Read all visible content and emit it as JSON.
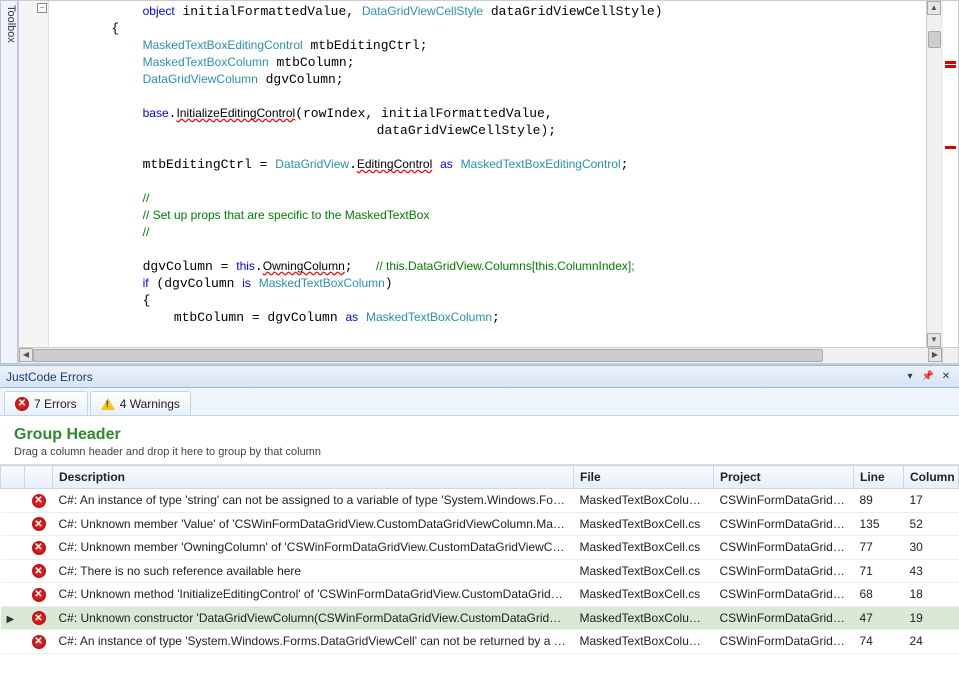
{
  "toolbox_label": "Toolbox",
  "code": {
    "lines": [
      {
        "indent": 12,
        "segs": [
          {
            "t": "object",
            "c": "kw"
          },
          {
            "t": " initialFormattedValue, "
          },
          {
            "t": "DataGridViewCellStyle",
            "c": "typ"
          },
          {
            "t": " dataGridViewCellStyle)"
          }
        ]
      },
      {
        "indent": 8,
        "segs": [
          {
            "t": "{"
          }
        ]
      },
      {
        "indent": 12,
        "segs": [
          {
            "t": "MaskedTextBoxEditingControl",
            "c": "typ"
          },
          {
            "t": " mtbEditingCtrl;"
          }
        ]
      },
      {
        "indent": 12,
        "segs": [
          {
            "t": "MaskedTextBoxColumn",
            "c": "typ"
          },
          {
            "t": " mtbColumn;"
          }
        ]
      },
      {
        "indent": 12,
        "segs": [
          {
            "t": "DataGridViewColumn",
            "c": "typ"
          },
          {
            "t": " dgvColumn;"
          }
        ]
      },
      {
        "indent": 0,
        "segs": [
          {
            "t": ""
          }
        ]
      },
      {
        "indent": 12,
        "segs": [
          {
            "t": "base",
            "c": "kw"
          },
          {
            "t": "."
          },
          {
            "t": "InitializeEditingControl",
            "c": "err"
          },
          {
            "t": "(rowIndex, initialFormattedValue,"
          }
        ]
      },
      {
        "indent": 42,
        "segs": [
          {
            "t": "dataGridViewCellStyle);"
          }
        ]
      },
      {
        "indent": 0,
        "segs": [
          {
            "t": ""
          }
        ]
      },
      {
        "indent": 12,
        "segs": [
          {
            "t": "mtbEditingCtrl = "
          },
          {
            "t": "DataGridView",
            "c": "typ"
          },
          {
            "t": "."
          },
          {
            "t": "EditingControl",
            "c": "err"
          },
          {
            "t": " "
          },
          {
            "t": "as",
            "c": "kw"
          },
          {
            "t": " "
          },
          {
            "t": "MaskedTextBoxEditingControl",
            "c": "typ"
          },
          {
            "t": ";"
          }
        ]
      },
      {
        "indent": 0,
        "segs": [
          {
            "t": ""
          }
        ]
      },
      {
        "indent": 12,
        "segs": [
          {
            "t": "//",
            "c": "cmt"
          }
        ]
      },
      {
        "indent": 12,
        "segs": [
          {
            "t": "// Set up props that are specific to the MaskedTextBox",
            "c": "cmt"
          }
        ]
      },
      {
        "indent": 12,
        "segs": [
          {
            "t": "//",
            "c": "cmt"
          }
        ]
      },
      {
        "indent": 0,
        "segs": [
          {
            "t": ""
          }
        ]
      },
      {
        "indent": 12,
        "segs": [
          {
            "t": "dgvColumn = "
          },
          {
            "t": "this",
            "c": "kw"
          },
          {
            "t": "."
          },
          {
            "t": "OwningColumn",
            "c": "err"
          },
          {
            "t": ";   "
          },
          {
            "t": "// this.DataGridView.Columns[this.ColumnIndex];",
            "c": "cmt"
          }
        ]
      },
      {
        "indent": 12,
        "segs": [
          {
            "t": "if",
            "c": "kw"
          },
          {
            "t": " (dgvColumn "
          },
          {
            "t": "is",
            "c": "kw"
          },
          {
            "t": " "
          },
          {
            "t": "MaskedTextBoxColumn",
            "c": "typ"
          },
          {
            "t": ")"
          }
        ]
      },
      {
        "indent": 12,
        "segs": [
          {
            "t": "{"
          }
        ]
      },
      {
        "indent": 16,
        "segs": [
          {
            "t": "mtbColumn = dgvColumn "
          },
          {
            "t": "as",
            "c": "kw"
          },
          {
            "t": " "
          },
          {
            "t": "MaskedTextBoxColumn",
            "c": "typ"
          },
          {
            "t": ";"
          }
        ]
      }
    ]
  },
  "panel": {
    "title": "JustCode Errors",
    "errors_tab": "7 Errors",
    "warnings_tab": "4 Warnings",
    "group_header": "Group Header",
    "group_hint": "Drag a column header and drop it here to group by that column",
    "columns": {
      "desc": "Description",
      "file": "File",
      "proj": "Project",
      "line": "Line",
      "col": "Column"
    },
    "rows": [
      {
        "desc": "C#: An instance of type 'string' can not be assigned to a variable of type 'System.Windows.Form…",
        "file": "MaskedTextBoxColumn.cs",
        "proj": "CSWinFormDataGridView",
        "line": "89",
        "col": "17"
      },
      {
        "desc": "C#: Unknown member 'Value' of 'CSWinFormDataGridView.CustomDataGridViewColumn.Mask…",
        "file": "MaskedTextBoxCell.cs",
        "proj": "CSWinFormDataGridView",
        "line": "135",
        "col": "52"
      },
      {
        "desc": "C#: Unknown member 'OwningColumn' of 'CSWinFormDataGridView.CustomDataGridViewCol…",
        "file": "MaskedTextBoxCell.cs",
        "proj": "CSWinFormDataGridView",
        "line": "77",
        "col": "30"
      },
      {
        "desc": "C#: There is no such reference available here",
        "file": "MaskedTextBoxCell.cs",
        "proj": "CSWinFormDataGridView",
        "line": "71",
        "col": "43"
      },
      {
        "desc": "C#: Unknown method 'InitializeEditingControl' of 'CSWinFormDataGridView.CustomDataGridVie…",
        "file": "MaskedTextBoxCell.cs",
        "proj": "CSWinFormDataGridView",
        "line": "68",
        "col": "18"
      },
      {
        "desc": "C#: Unknown constructor 'DataGridViewColumn(CSWinFormDataGridView.CustomDataGridVie…",
        "file": "MaskedTextBoxColumn.cs",
        "proj": "CSWinFormDataGridView",
        "line": "47",
        "col": "19",
        "sel": true
      },
      {
        "desc": "C#: An instance of type 'System.Windows.Forms.DataGridViewCell' can not be returned by a m…",
        "file": "MaskedTextBoxColumn.cs",
        "proj": "CSWinFormDataGridView",
        "line": "74",
        "col": "24"
      }
    ]
  }
}
